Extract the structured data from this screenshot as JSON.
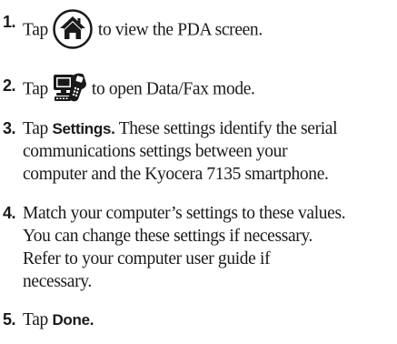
{
  "steps": [
    {
      "number": "1.",
      "before": "Tap",
      "icon": "home-icon",
      "after": "to view the PDA screen."
    },
    {
      "number": "2.",
      "before": "Tap",
      "icon": "data-fax-icon",
      "after": "to open Data/Fax mode."
    },
    {
      "number": "3.",
      "before": "Tap",
      "bold": "Settings.",
      "after": "These settings identify the serial",
      "lines": [
        "communications settings between your",
        "computer and the Kyocera 7135 smartphone."
      ]
    },
    {
      "number": "4.",
      "lines": [
        "Match your computer’s settings to these values.",
        "You can change these settings if necessary.",
        "Refer to your computer user guide if",
        "necessary."
      ]
    },
    {
      "number": "5.",
      "before": "Tap",
      "bold": "Done."
    }
  ]
}
